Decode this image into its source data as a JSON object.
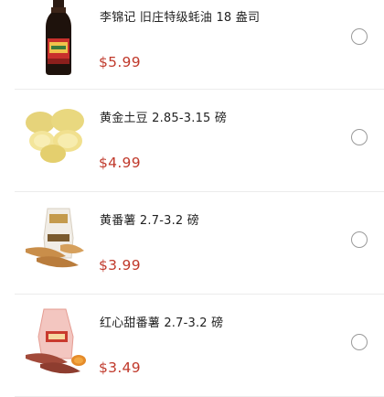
{
  "products": [
    {
      "name": "李锦记 旧庄特级蚝油 18 盎司",
      "price": "$5.99",
      "thumb_icon": "oyster-sauce-bottle-icon"
    },
    {
      "name": "黄金土豆 2.85-3.15 磅",
      "price": "$4.99",
      "thumb_icon": "yellow-potatoes-icon"
    },
    {
      "name": "黄番薯 2.7-3.2 磅",
      "price": "$3.99",
      "thumb_icon": "yellow-sweet-potatoes-icon"
    },
    {
      "name": "红心甜番薯 2.7-3.2 磅",
      "price": "$3.49",
      "thumb_icon": "red-sweet-potatoes-icon"
    }
  ],
  "colors": {
    "price": "#c0392b",
    "divider": "#ececec",
    "radio_border": "#9a9a9a"
  }
}
